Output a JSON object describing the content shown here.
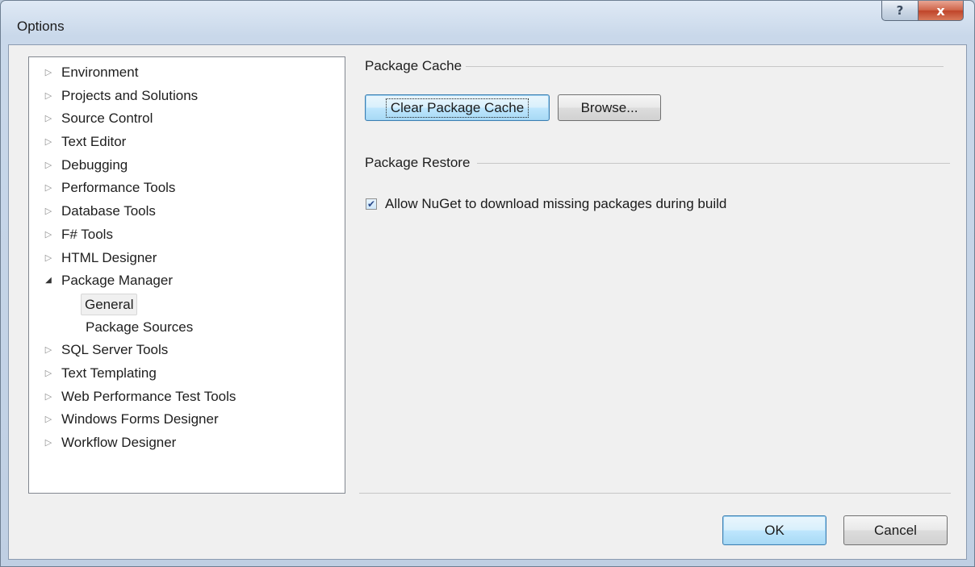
{
  "window": {
    "title": "Options",
    "help_icon": "?",
    "close_icon": "x"
  },
  "tree": {
    "items": [
      {
        "label": "Environment",
        "expanded": false
      },
      {
        "label": "Projects and Solutions",
        "expanded": false
      },
      {
        "label": "Source Control",
        "expanded": false
      },
      {
        "label": "Text Editor",
        "expanded": false
      },
      {
        "label": "Debugging",
        "expanded": false
      },
      {
        "label": "Performance Tools",
        "expanded": false
      },
      {
        "label": "Database Tools",
        "expanded": false
      },
      {
        "label": "F# Tools",
        "expanded": false
      },
      {
        "label": "HTML Designer",
        "expanded": false
      },
      {
        "label": "Package Manager",
        "expanded": true
      },
      {
        "label": "General",
        "child": true,
        "selected": true
      },
      {
        "label": "Package Sources",
        "child": true
      },
      {
        "label": "SQL Server Tools",
        "expanded": false
      },
      {
        "label": "Text Templating",
        "expanded": false
      },
      {
        "label": "Web Performance Test Tools",
        "expanded": false
      },
      {
        "label": "Windows Forms Designer",
        "expanded": false
      },
      {
        "label": "Workflow Designer",
        "expanded": false
      }
    ]
  },
  "package_cache": {
    "group_title": "Package Cache",
    "clear_button": "Clear Package Cache",
    "browse_button": "Browse..."
  },
  "package_restore": {
    "group_title": "Package Restore",
    "allow_download_label": "Allow NuGet to download missing packages during build",
    "allow_download_checked": true
  },
  "footer": {
    "ok_button": "OK",
    "cancel_button": "Cancel"
  },
  "colors": {
    "title_gradient_top": "#dfe9f5",
    "client_background": "#f0f0f0",
    "close_button": "#c7452b",
    "focused_button_border": "#3c7fb1"
  }
}
